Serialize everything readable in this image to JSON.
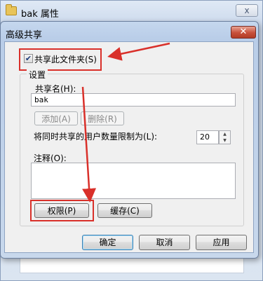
{
  "window": {
    "title": "bak 属性",
    "close_glyph": "x"
  },
  "dialog": {
    "title": "高级共享",
    "close_glyph": "✕",
    "share_checkbox": {
      "label": "共享此文件夹(S)",
      "checked": true,
      "check_glyph": "✔"
    },
    "settings": {
      "group_label": "设置",
      "share_name_label": "共享名(H):",
      "share_name_value": "bak",
      "add_button": "添加(A)",
      "delete_button": "删除(R)",
      "user_limit_label": "将同时共享的用户数量限制为(L):",
      "user_limit_value": "20",
      "comment_label": "注释(O):",
      "comment_value": "",
      "permissions_button": "权限(P)",
      "caching_button": "缓存(C)"
    },
    "footer": {
      "ok": "确定",
      "cancel": "取消",
      "apply": "应用"
    }
  },
  "annotations": {
    "highlight_color": "#d9302a"
  }
}
